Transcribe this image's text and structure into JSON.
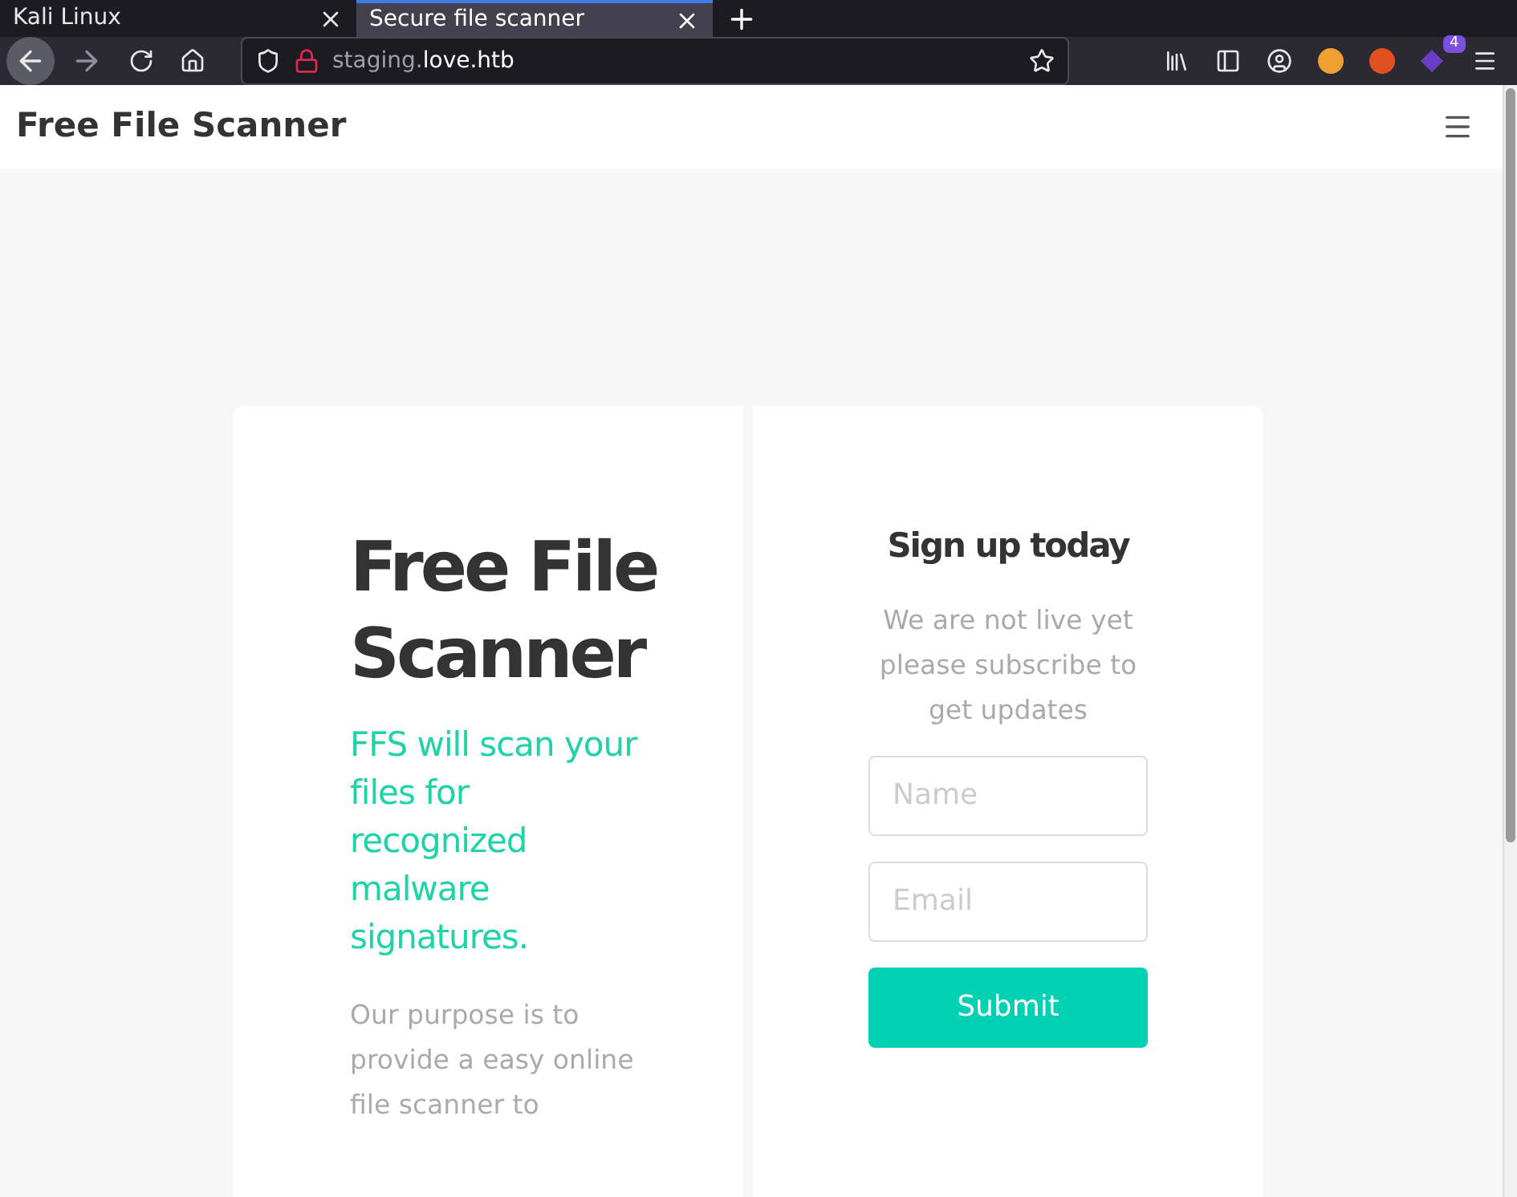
{
  "browser": {
    "tabs": [
      {
        "label": "Kali Linux",
        "selected": false
      },
      {
        "label": "Secure file scanner",
        "selected": true
      }
    ],
    "url": {
      "dim": "staging.",
      "main": "love.htb"
    },
    "extension_badge": "4"
  },
  "navbar": {
    "brand": "Free File Scanner"
  },
  "hero": {
    "title": "Free File Scanner",
    "tagline": "FFS will scan your files for recognized malware signatures.",
    "body": "Our purpose is to provide a easy online file scanner to"
  },
  "signup": {
    "title": "Sign up today",
    "text": "We are not live yet please subscribe to get updates",
    "fields": [
      {
        "placeholder": "Name"
      },
      {
        "placeholder": "Email"
      }
    ],
    "button": "Submit"
  }
}
